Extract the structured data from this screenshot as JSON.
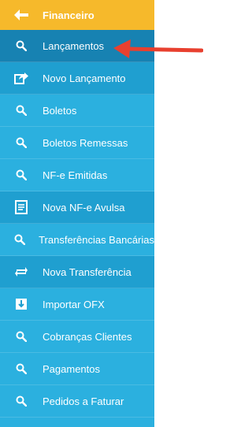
{
  "header": {
    "label": "Financeiro",
    "icon": "back-arrow-icon"
  },
  "menu": [
    {
      "label": "Lançamentos",
      "icon": "search-icon",
      "active": true
    },
    {
      "label": "Novo Lançamento",
      "icon": "share-icon"
    },
    {
      "label": "Boletos",
      "icon": "search-icon"
    },
    {
      "label": "Boletos Remessas",
      "icon": "search-icon"
    },
    {
      "label": "NF-e Emitidas",
      "icon": "search-icon"
    },
    {
      "label": "Nova NF-e Avulsa",
      "icon": "document-icon"
    },
    {
      "label": "Transferências Bancárias",
      "icon": "search-icon"
    },
    {
      "label": "Nova Transferência",
      "icon": "transfer-icon"
    },
    {
      "label": "Importar OFX",
      "icon": "import-folder-icon"
    },
    {
      "label": "Cobranças Clientes",
      "icon": "search-icon"
    },
    {
      "label": "Pagamentos",
      "icon": "search-icon"
    },
    {
      "label": "Pedidos a Faturar",
      "icon": "search-icon"
    }
  ],
  "colors": {
    "header": "#f6b92b",
    "sidebar": "#2bb0df",
    "sidebar_alt": "#1f9fd0",
    "active": "#1782b2",
    "annotation_arrow": "#e8402f"
  }
}
